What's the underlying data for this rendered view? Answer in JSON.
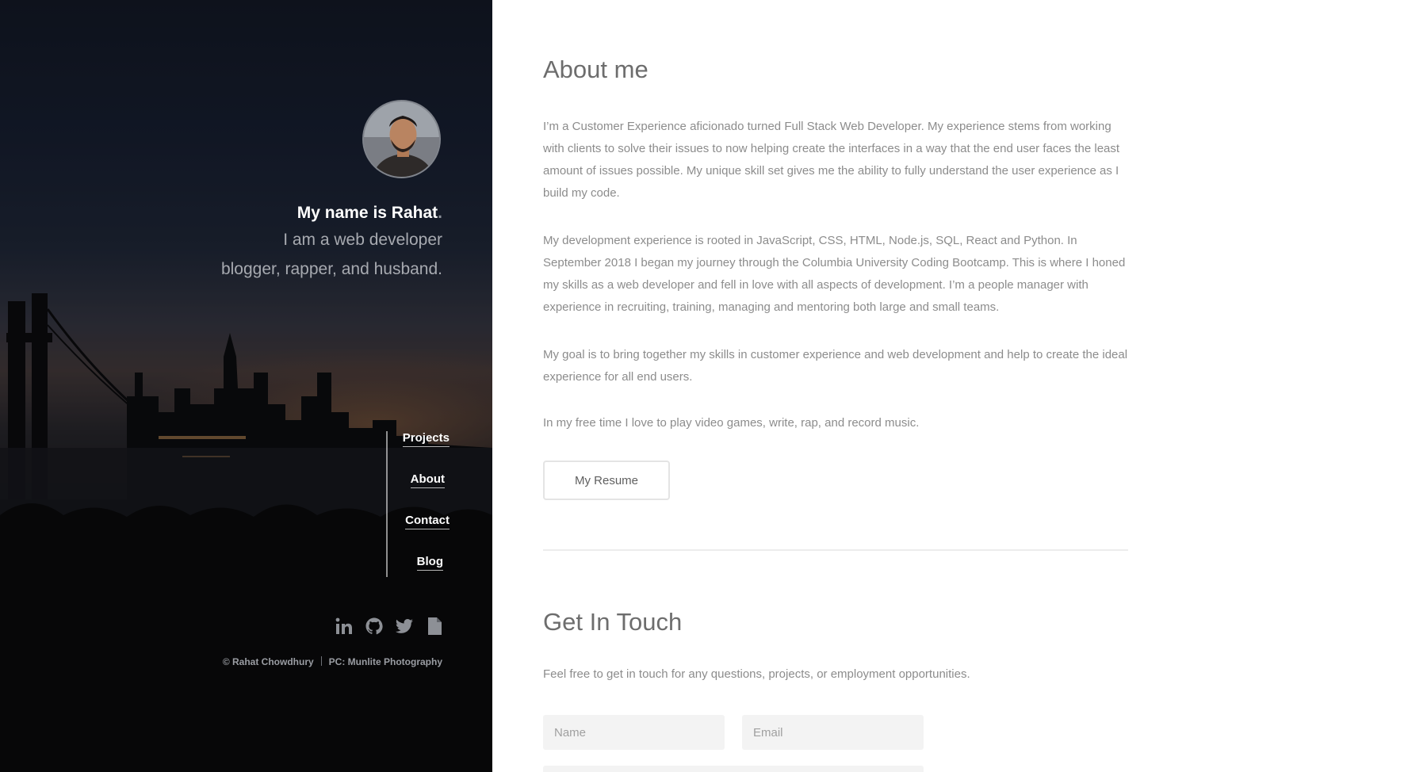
{
  "profile": {
    "name_line": "My name is Rahat",
    "name_dot": ".",
    "tagline_1": "I am a web developer",
    "tagline_2": "blogger, rapper, and husband."
  },
  "nav": {
    "items": [
      {
        "label": "Projects"
      },
      {
        "label": "About"
      },
      {
        "label": "Contact"
      },
      {
        "label": "Blog"
      }
    ]
  },
  "social": {
    "icons": [
      "linkedin-icon",
      "github-icon",
      "twitter-icon",
      "document-icon"
    ]
  },
  "credits": {
    "copyright": "© Rahat Chowdhury",
    "photo": "PC: Munlite Photography"
  },
  "about": {
    "title": "About me",
    "paragraphs": [
      "I’m a Customer Experience aficionado turned Full Stack Web Developer. My experience stems from working with clients to solve their issues to now helping create the interfaces in a way that the end user faces the least amount of issues possible. My unique skill set gives me the ability to fully understand the user experience as I build my code.",
      "My development experience is rooted in JavaScript, CSS, HTML, Node.js, SQL, React and Python. In September 2018 I began my journey through the Columbia University Coding Bootcamp. This is where I honed my skills as a web developer and fell in love with all aspects of development. I’m a people manager with experience in recruiting, training, managing and mentoring both large and small teams.",
      "My goal is to bring together my skills in customer experience and web development and help to create the ideal experience for all end users.",
      "In my free time I love to play video games, write, rap, and record music."
    ],
    "resume_label": "My Resume"
  },
  "contact": {
    "title": "Get In Touch",
    "text": "Feel free to get in touch for any questions, projects, or employment opportunities.",
    "name_placeholder": "Name",
    "email_placeholder": "Email"
  },
  "colors": {
    "sidebar_dark": "#151619",
    "heading_gray": "#6d6d6d",
    "body_gray": "#8c8c8c",
    "field_bg": "#f3f3f3"
  }
}
